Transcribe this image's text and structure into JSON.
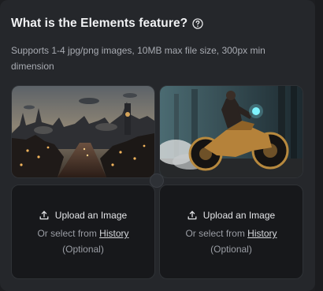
{
  "header": {
    "title": "What is the Elements feature?",
    "help_icon": "help-circle-icon"
  },
  "subtitle": "Supports 1-4 jpg/png images, 10MB max file size, 300px min dimension",
  "images": [
    {
      "name": "steampunk-city-image",
      "alt": "Steampunk city with airships"
    },
    {
      "name": "steampunk-motorcycle-image",
      "alt": "Rider on steampunk motorcycle"
    }
  ],
  "uploads": [
    {
      "icon": "upload-icon",
      "label": "Upload an Image",
      "select_prefix": "Or select from",
      "history_link": "History",
      "optional": "(Optional)"
    },
    {
      "icon": "upload-icon",
      "label": "Upload an Image",
      "select_prefix": "Or select from",
      "history_link": "History",
      "optional": "(Optional)"
    }
  ],
  "colors": {
    "panel_bg": "#25272b",
    "card_bg": "#17181b",
    "text_primary": "#f1f2f4",
    "text_secondary": "#a8abb2"
  }
}
